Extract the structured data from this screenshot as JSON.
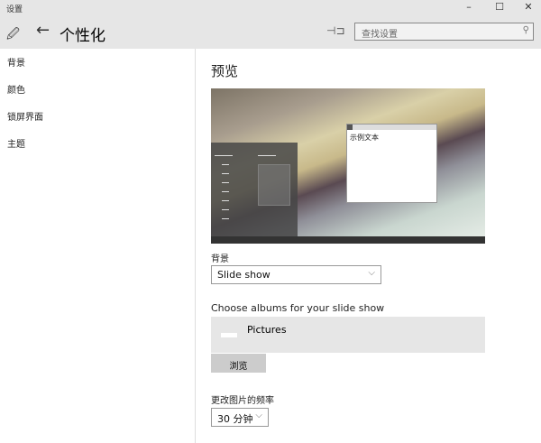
{
  "window": {
    "title": "设置",
    "minimize": "–",
    "maximize": "☐",
    "close": "✕"
  },
  "header": {
    "title": "个性化",
    "back": "←",
    "pin": "⊣⊐",
    "search_placeholder": "查找设置",
    "search_icon": "⚲"
  },
  "sidebar": {
    "items": [
      {
        "label": "背景"
      },
      {
        "label": "颜色"
      },
      {
        "label": "锁屏界面"
      },
      {
        "label": "主题"
      }
    ]
  },
  "main": {
    "preview_title": "预览",
    "preview_sample_text": "示例文本",
    "background_label": "背景",
    "background_value": "Slide show",
    "albums_label": "Choose albums for your slide show",
    "album_name": "Pictures",
    "browse_label": "浏览",
    "frequency_label": "更改图片的频率",
    "frequency_value": "30 分钟"
  }
}
